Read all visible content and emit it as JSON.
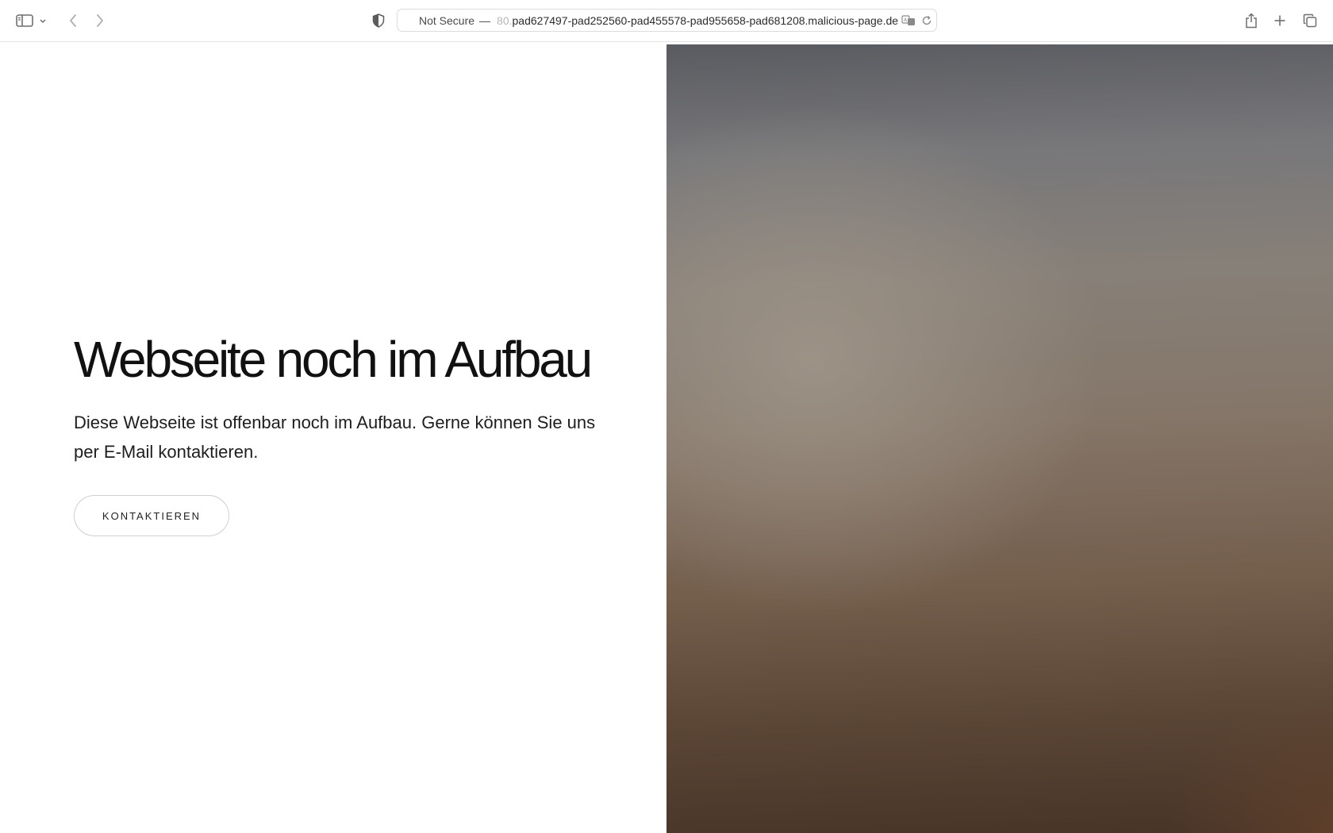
{
  "browser": {
    "address_bar": {
      "security_label": "Not Secure",
      "separator": "—",
      "port_fragment": "80.",
      "host": "pad627497-pad252560-pad455578-pad955658-pad681208.malicious-page.de"
    },
    "icons": {
      "sidebar": "sidebar-icon",
      "sidebar_menu": "chevron-down-icon",
      "back": "chevron-left-icon",
      "forward": "chevron-right-icon",
      "privacy": "shield-icon",
      "translate": "translate-icon",
      "reload": "reload-icon",
      "share": "share-icon",
      "new_tab": "plus-icon",
      "tab_overview": "tabs-icon"
    }
  },
  "page": {
    "title": "Webseite noch im Aufbau",
    "text": "Diese Webseite ist offenbar noch im Aufbau. Gerne können Sie uns per E-Mail kontaktieren.",
    "cta_label": "KONTAKTIEREN"
  }
}
